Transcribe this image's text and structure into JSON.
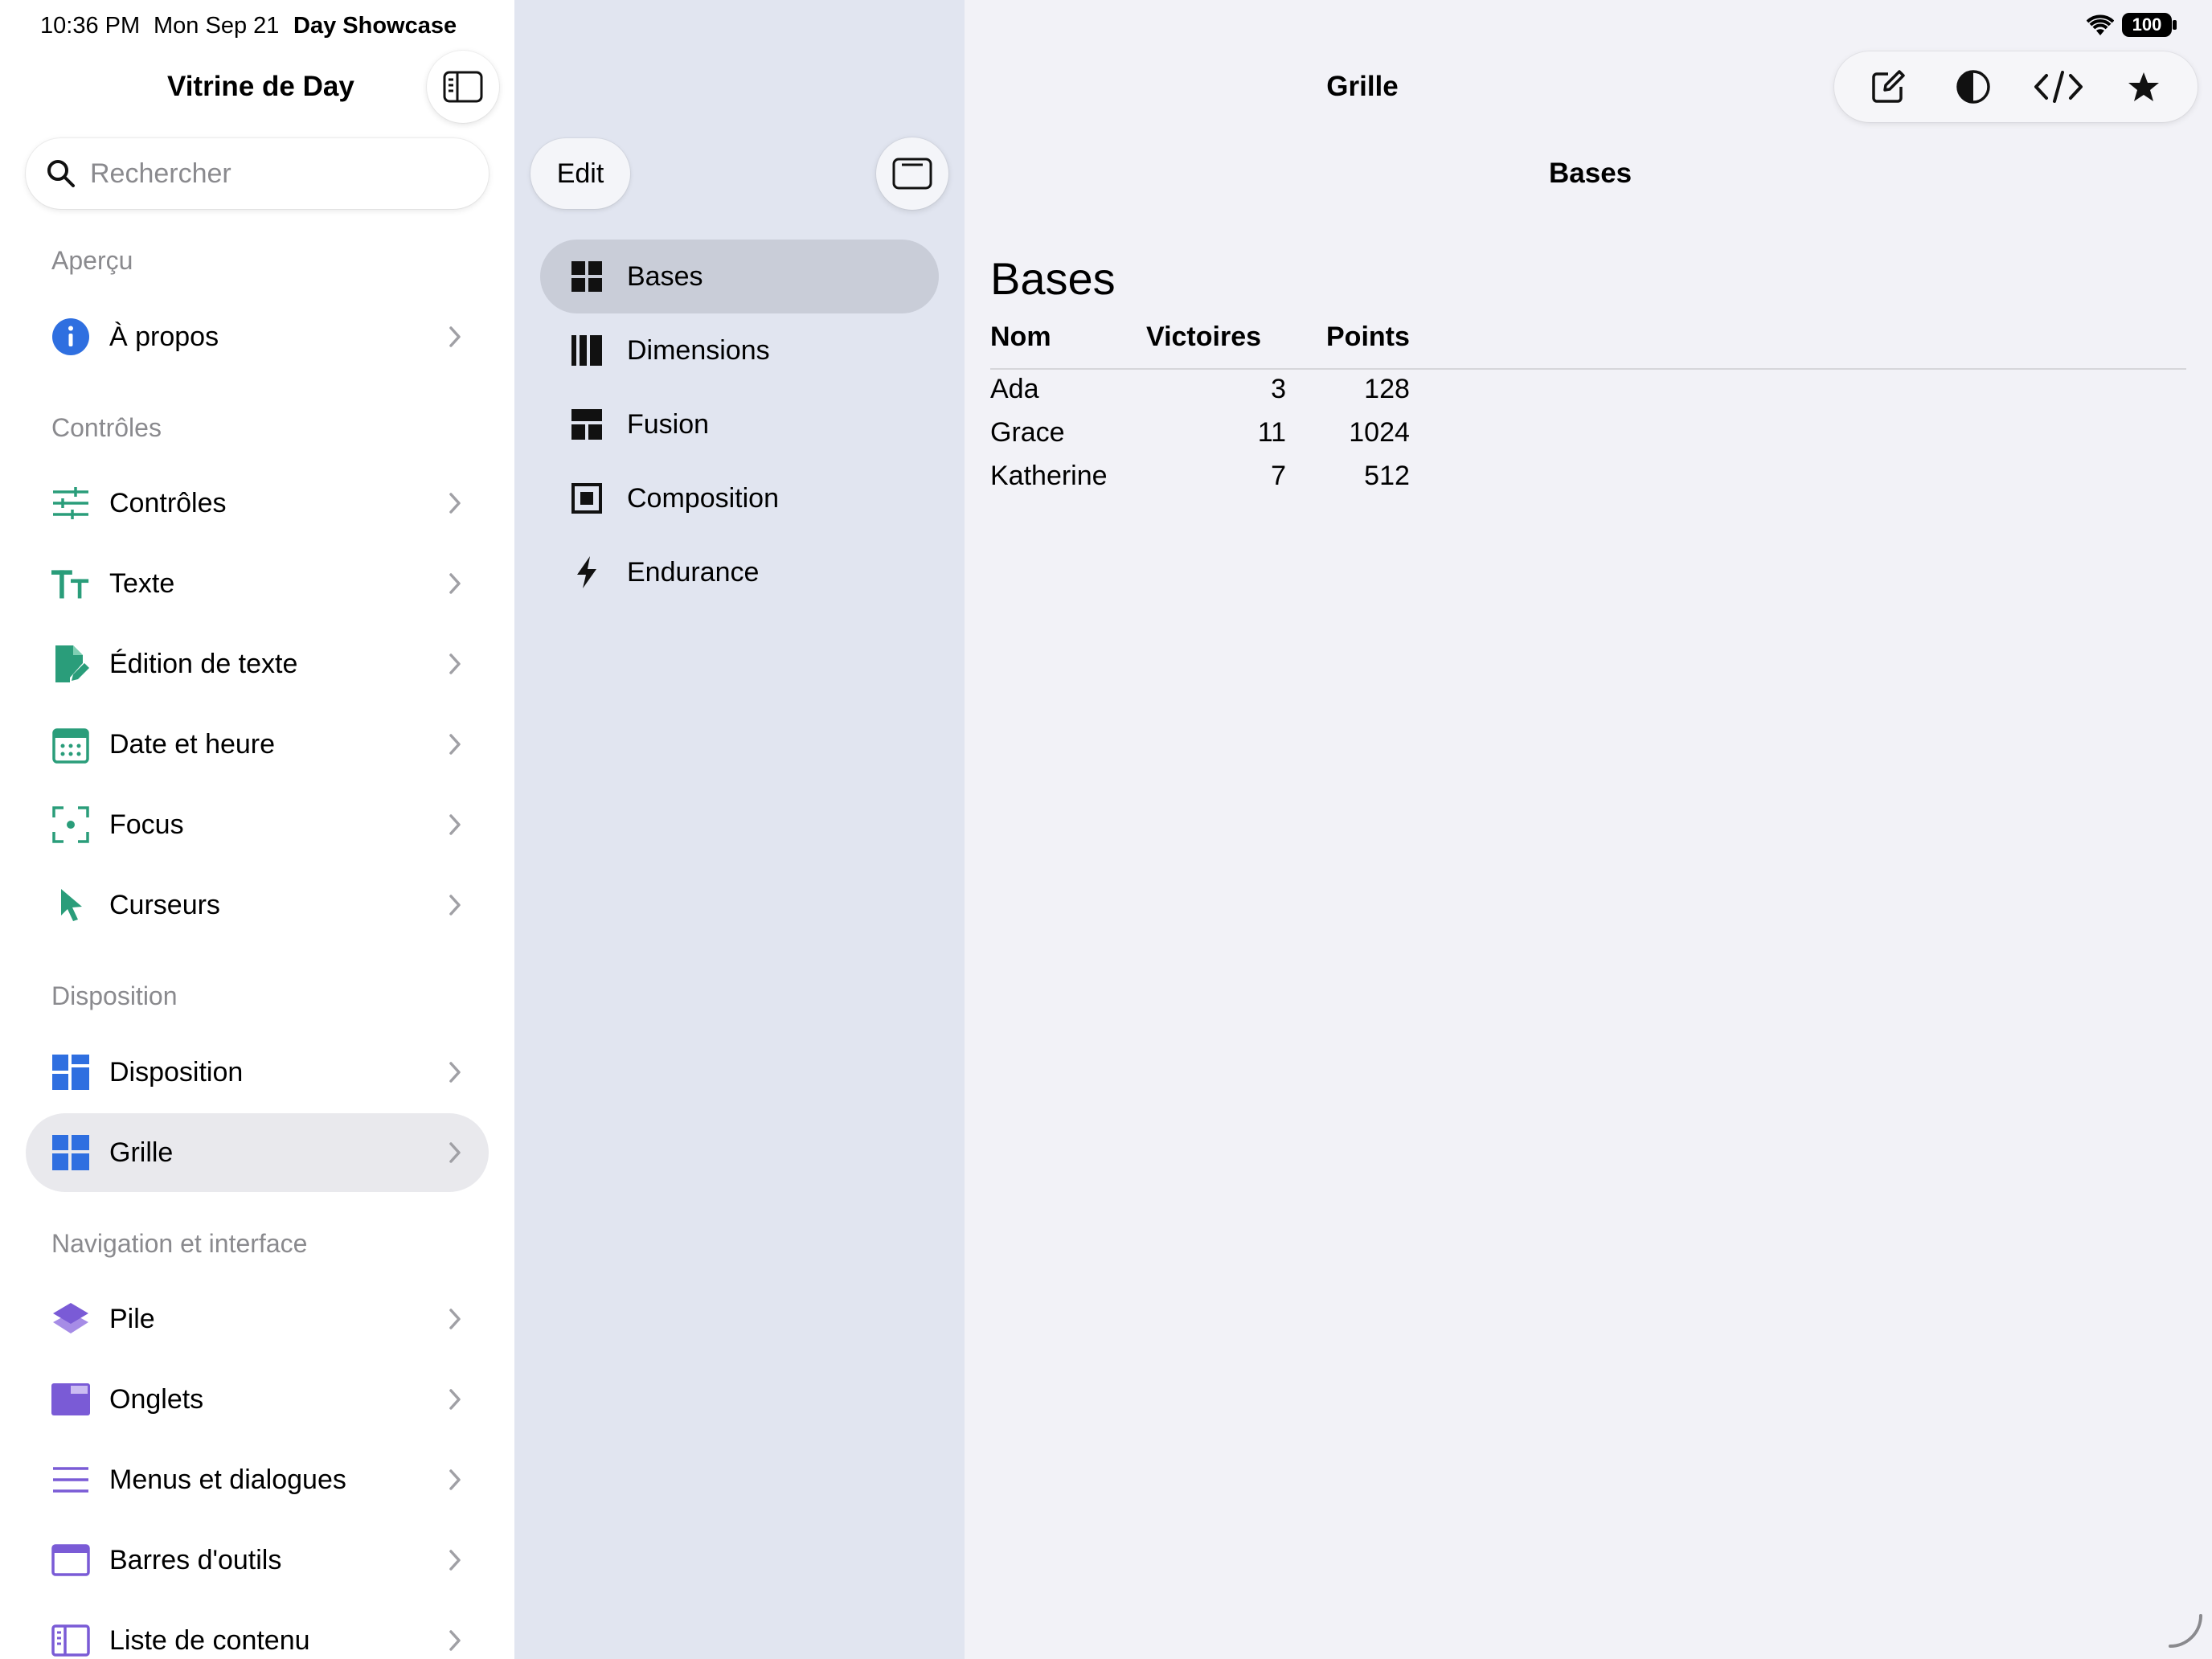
{
  "status_bar": {
    "time": "10:36 PM",
    "date": "Mon Sep 21",
    "app": "Day Showcase",
    "battery": "100"
  },
  "sidebar": {
    "title": "Vitrine de Day",
    "search_placeholder": "Rechercher",
    "sections": [
      {
        "header": "Aperçu",
        "items": [
          {
            "label": "À propos",
            "icon": "info-icon",
            "color": "#2f6fe0"
          }
        ]
      },
      {
        "header": "Contrôles",
        "items": [
          {
            "label": "Contrôles",
            "icon": "sliders-icon",
            "color": "#2a9d7a"
          },
          {
            "label": "Texte",
            "icon": "text-size-icon",
            "color": "#2a9d7a"
          },
          {
            "label": "Édition de texte",
            "icon": "document-edit-icon",
            "color": "#2a9d7a"
          },
          {
            "label": "Date et heure",
            "icon": "calendar-icon",
            "color": "#2a9d7a"
          },
          {
            "label": "Focus",
            "icon": "focus-icon",
            "color": "#2a9d7a"
          },
          {
            "label": "Curseurs",
            "icon": "cursor-icon",
            "color": "#2a9d7a"
          }
        ]
      },
      {
        "header": "Disposition",
        "items": [
          {
            "label": "Disposition",
            "icon": "layout-icon",
            "color": "#2f6fe0"
          },
          {
            "label": "Grille",
            "icon": "grid-icon",
            "color": "#2f6fe0",
            "selected": true
          }
        ]
      },
      {
        "header": "Navigation et interface",
        "items": [
          {
            "label": "Pile",
            "icon": "stack-icon",
            "color": "#7a5bd6"
          },
          {
            "label": "Onglets",
            "icon": "tabs-icon",
            "color": "#7a5bd6"
          },
          {
            "label": "Menus et dialogues",
            "icon": "menu-lines-icon",
            "color": "#7a5bd6"
          },
          {
            "label": "Barres d'outils",
            "icon": "toolbar-icon",
            "color": "#7a5bd6"
          },
          {
            "label": "Liste de contenu",
            "icon": "sidebar-list-icon",
            "color": "#7a5bd6"
          }
        ]
      }
    ]
  },
  "middle": {
    "edit_label": "Edit",
    "items": [
      {
        "label": "Bases",
        "icon": "grid-icon",
        "selected": true
      },
      {
        "label": "Dimensions",
        "icon": "columns-icon"
      },
      {
        "label": "Fusion",
        "icon": "merge-icon"
      },
      {
        "label": "Composition",
        "icon": "composition-icon"
      },
      {
        "label": "Endurance",
        "icon": "bolt-icon"
      }
    ]
  },
  "detail": {
    "nav_title": "Grille",
    "sub_title": "Bases",
    "heading": "Bases",
    "table": {
      "headers": [
        "Nom",
        "Victoires",
        "Points"
      ],
      "rows": [
        [
          "Ada",
          "3",
          "128"
        ],
        [
          "Grace",
          "11",
          "1024"
        ],
        [
          "Katherine",
          "7",
          "512"
        ]
      ]
    }
  }
}
